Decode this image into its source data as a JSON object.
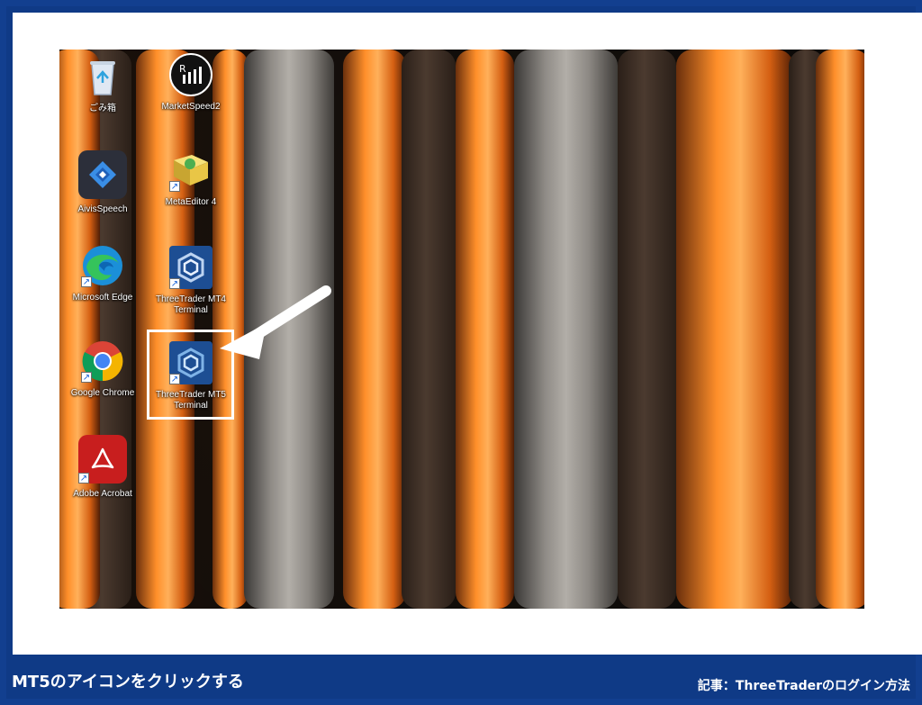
{
  "desktop": {
    "icons": [
      {
        "label": "ごみ箱"
      },
      {
        "label": "MarketSpeed2"
      },
      {
        "label": "AivisSpeech"
      },
      {
        "label": "MetaEditor 4"
      },
      {
        "label": "Microsoft Edge"
      },
      {
        "label": "ThreeTrader MT4 Terminal"
      },
      {
        "label": "Google Chrome"
      },
      {
        "label": "ThreeTrader MT5 Terminal"
      },
      {
        "label": "Adobe Acrobat"
      }
    ]
  },
  "caption": {
    "title": "MT5のアイコンをクリックする",
    "source": "記事：ThreeTraderのログイン方法"
  },
  "colors": {
    "frame_blue": "#0f3a86",
    "highlight": "#ffffff"
  }
}
